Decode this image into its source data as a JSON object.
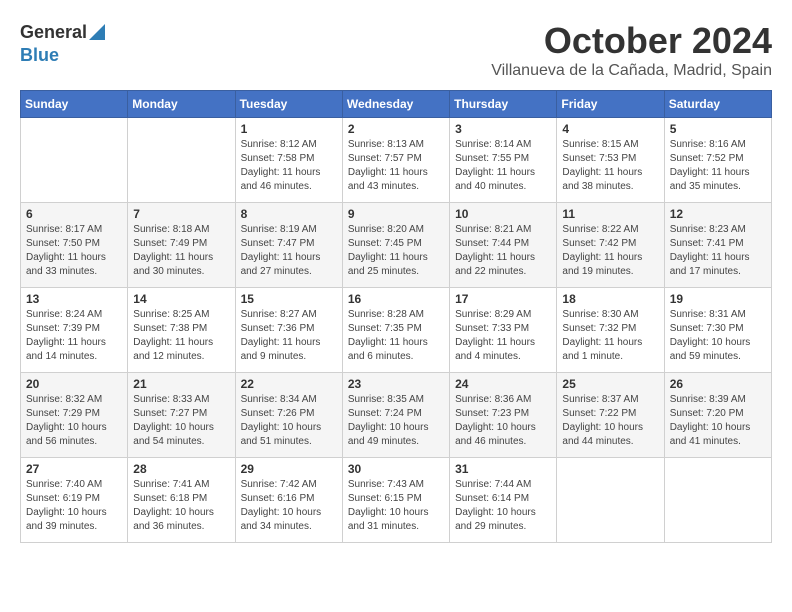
{
  "header": {
    "logo_general": "General",
    "logo_blue": "Blue",
    "month_title": "October 2024",
    "location": "Villanueva de la Cañada, Madrid, Spain"
  },
  "weekdays": [
    "Sunday",
    "Monday",
    "Tuesday",
    "Wednesday",
    "Thursday",
    "Friday",
    "Saturday"
  ],
  "weeks": [
    [
      {
        "day": "",
        "info": ""
      },
      {
        "day": "",
        "info": ""
      },
      {
        "day": "1",
        "info": "Sunrise: 8:12 AM\nSunset: 7:58 PM\nDaylight: 11 hours and 46 minutes."
      },
      {
        "day": "2",
        "info": "Sunrise: 8:13 AM\nSunset: 7:57 PM\nDaylight: 11 hours and 43 minutes."
      },
      {
        "day": "3",
        "info": "Sunrise: 8:14 AM\nSunset: 7:55 PM\nDaylight: 11 hours and 40 minutes."
      },
      {
        "day": "4",
        "info": "Sunrise: 8:15 AM\nSunset: 7:53 PM\nDaylight: 11 hours and 38 minutes."
      },
      {
        "day": "5",
        "info": "Sunrise: 8:16 AM\nSunset: 7:52 PM\nDaylight: 11 hours and 35 minutes."
      }
    ],
    [
      {
        "day": "6",
        "info": "Sunrise: 8:17 AM\nSunset: 7:50 PM\nDaylight: 11 hours and 33 minutes."
      },
      {
        "day": "7",
        "info": "Sunrise: 8:18 AM\nSunset: 7:49 PM\nDaylight: 11 hours and 30 minutes."
      },
      {
        "day": "8",
        "info": "Sunrise: 8:19 AM\nSunset: 7:47 PM\nDaylight: 11 hours and 27 minutes."
      },
      {
        "day": "9",
        "info": "Sunrise: 8:20 AM\nSunset: 7:45 PM\nDaylight: 11 hours and 25 minutes."
      },
      {
        "day": "10",
        "info": "Sunrise: 8:21 AM\nSunset: 7:44 PM\nDaylight: 11 hours and 22 minutes."
      },
      {
        "day": "11",
        "info": "Sunrise: 8:22 AM\nSunset: 7:42 PM\nDaylight: 11 hours and 19 minutes."
      },
      {
        "day": "12",
        "info": "Sunrise: 8:23 AM\nSunset: 7:41 PM\nDaylight: 11 hours and 17 minutes."
      }
    ],
    [
      {
        "day": "13",
        "info": "Sunrise: 8:24 AM\nSunset: 7:39 PM\nDaylight: 11 hours and 14 minutes."
      },
      {
        "day": "14",
        "info": "Sunrise: 8:25 AM\nSunset: 7:38 PM\nDaylight: 11 hours and 12 minutes."
      },
      {
        "day": "15",
        "info": "Sunrise: 8:27 AM\nSunset: 7:36 PM\nDaylight: 11 hours and 9 minutes."
      },
      {
        "day": "16",
        "info": "Sunrise: 8:28 AM\nSunset: 7:35 PM\nDaylight: 11 hours and 6 minutes."
      },
      {
        "day": "17",
        "info": "Sunrise: 8:29 AM\nSunset: 7:33 PM\nDaylight: 11 hours and 4 minutes."
      },
      {
        "day": "18",
        "info": "Sunrise: 8:30 AM\nSunset: 7:32 PM\nDaylight: 11 hours and 1 minute."
      },
      {
        "day": "19",
        "info": "Sunrise: 8:31 AM\nSunset: 7:30 PM\nDaylight: 10 hours and 59 minutes."
      }
    ],
    [
      {
        "day": "20",
        "info": "Sunrise: 8:32 AM\nSunset: 7:29 PM\nDaylight: 10 hours and 56 minutes."
      },
      {
        "day": "21",
        "info": "Sunrise: 8:33 AM\nSunset: 7:27 PM\nDaylight: 10 hours and 54 minutes."
      },
      {
        "day": "22",
        "info": "Sunrise: 8:34 AM\nSunset: 7:26 PM\nDaylight: 10 hours and 51 minutes."
      },
      {
        "day": "23",
        "info": "Sunrise: 8:35 AM\nSunset: 7:24 PM\nDaylight: 10 hours and 49 minutes."
      },
      {
        "day": "24",
        "info": "Sunrise: 8:36 AM\nSunset: 7:23 PM\nDaylight: 10 hours and 46 minutes."
      },
      {
        "day": "25",
        "info": "Sunrise: 8:37 AM\nSunset: 7:22 PM\nDaylight: 10 hours and 44 minutes."
      },
      {
        "day": "26",
        "info": "Sunrise: 8:39 AM\nSunset: 7:20 PM\nDaylight: 10 hours and 41 minutes."
      }
    ],
    [
      {
        "day": "27",
        "info": "Sunrise: 7:40 AM\nSunset: 6:19 PM\nDaylight: 10 hours and 39 minutes."
      },
      {
        "day": "28",
        "info": "Sunrise: 7:41 AM\nSunset: 6:18 PM\nDaylight: 10 hours and 36 minutes."
      },
      {
        "day": "29",
        "info": "Sunrise: 7:42 AM\nSunset: 6:16 PM\nDaylight: 10 hours and 34 minutes."
      },
      {
        "day": "30",
        "info": "Sunrise: 7:43 AM\nSunset: 6:15 PM\nDaylight: 10 hours and 31 minutes."
      },
      {
        "day": "31",
        "info": "Sunrise: 7:44 AM\nSunset: 6:14 PM\nDaylight: 10 hours and 29 minutes."
      },
      {
        "day": "",
        "info": ""
      },
      {
        "day": "",
        "info": ""
      }
    ]
  ]
}
